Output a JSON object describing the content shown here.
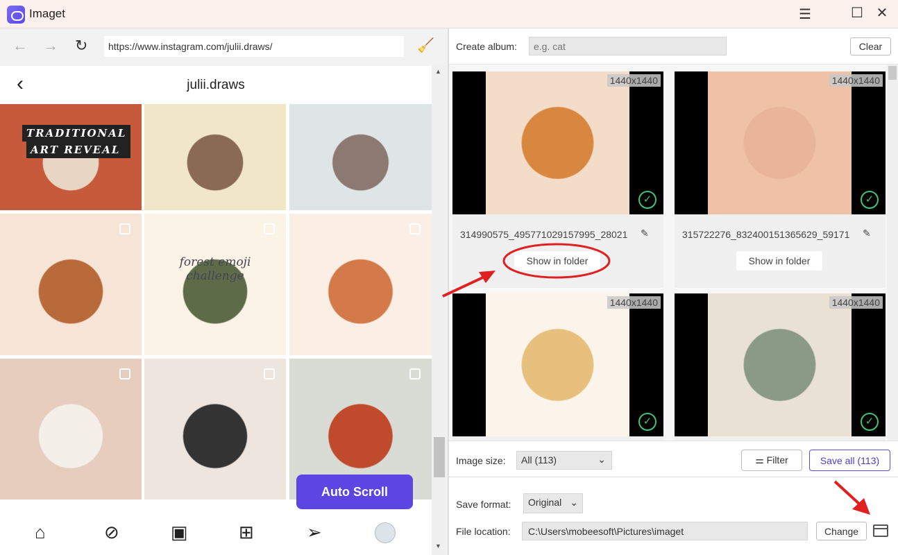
{
  "app": {
    "title": "Imaget",
    "window_controls": [
      "menu-icon",
      "maximize-icon",
      "close-icon"
    ]
  },
  "browser": {
    "url": "https://www.instagram.com/julii.draws/"
  },
  "instagram": {
    "profile_name": "julii.draws",
    "post_overlay_text": [
      "TRADITIONAL",
      "ART REVEAL",
      "forest emoji challenge"
    ],
    "tiles": [
      {
        "colors": [
          "#c85a3c",
          "#e8d6c4"
        ]
      },
      {
        "colors": [
          "#f1e6c8",
          "#8a6a55"
        ]
      },
      {
        "colors": [
          "#dfe4e6",
          "#8c7a72"
        ]
      },
      {
        "colors": [
          "#f6e4d6",
          "#b86a3a"
        ]
      },
      {
        "colors": [
          "#fbf3e6",
          "#5e6b48"
        ]
      },
      {
        "colors": [
          "#fbeee4",
          "#d47a4a"
        ]
      },
      {
        "colors": [
          "#e6cdbd",
          "#f4efe8"
        ]
      },
      {
        "colors": [
          "#efe5df",
          "#333333"
        ]
      },
      {
        "colors": [
          "#d8dcd4",
          "#c04a2c"
        ]
      }
    ],
    "auto_scroll_label": "Auto Scroll",
    "bottom_nav": [
      "home-icon",
      "explore-icon",
      "reels-icon",
      "create-icon",
      "direct-icon",
      "profile-avatar"
    ]
  },
  "album": {
    "label": "Create album:",
    "placeholder": "e.g. cat",
    "clear_label": "Clear"
  },
  "cards": [
    {
      "dimensions": "1440x1440",
      "filename": "314990575_495771029157995_28021",
      "show_in_folder": "Show in folder",
      "selected": true,
      "colors": [
        "#f3dcc8",
        "#d8873e"
      ]
    },
    {
      "dimensions": "1440x1440",
      "filename": "315722276_832400151365629_59171",
      "show_in_folder": "Show in folder",
      "selected": true,
      "colors": [
        "#efc1a6",
        "#e8b49a"
      ]
    },
    {
      "dimensions": "1440x1440",
      "selected": true,
      "colors": [
        "#fbf4ea",
        "#e6c07c"
      ]
    },
    {
      "dimensions": "1440x1440",
      "selected": true,
      "colors": [
        "#e9e2d4",
        "#8b9a86"
      ]
    }
  ],
  "footer": {
    "image_size_label": "Image size:",
    "image_size_value": "All (113)",
    "filter_label": "Filter",
    "save_all_label": "Save all (113)",
    "save_format_label": "Save format:",
    "save_format_value": "Original",
    "file_location_label": "File location:",
    "file_location_value": "C:\\Users\\mobeesoft\\Pictures\\imaget",
    "change_label": "Change"
  },
  "colors": {
    "accent": "#5b45e3",
    "annotation": "#e02020",
    "check": "#3fc57a"
  }
}
